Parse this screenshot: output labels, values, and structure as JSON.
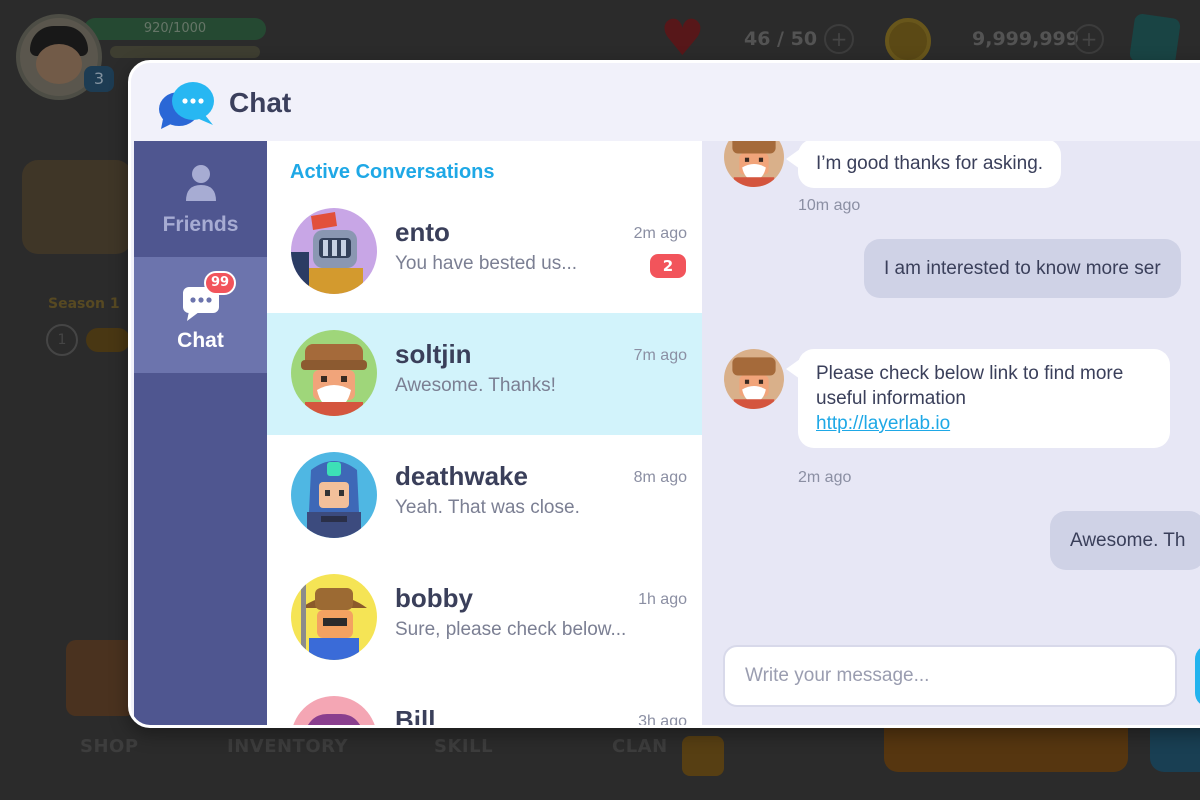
{
  "background": {
    "xp_text": "920/1000",
    "player_level": "3",
    "hearts_text": "46 / 50",
    "coins_text": "9,999,999",
    "season_label": "Season 1",
    "season_number": "1",
    "nav": [
      "SHOP",
      "INVENTORY",
      "SKILL",
      "CLAN"
    ]
  },
  "window": {
    "title": "Chat",
    "icon": "chat-bubbles-icon"
  },
  "sidebar": {
    "items": [
      {
        "label": "Friends",
        "icon": "person-icon"
      },
      {
        "label": "Chat",
        "icon": "chat-icon",
        "badge": "99"
      }
    ]
  },
  "conversations": {
    "heading": "Active Conversations",
    "items": [
      {
        "name": "ento",
        "time": "2m ago",
        "preview": "You have bested us...",
        "unread": "2",
        "avatar": "knight-avatar"
      },
      {
        "name": "soltjin",
        "time": "7m ago",
        "preview": "Awesome. Thanks!",
        "avatar": "old-man-avatar"
      },
      {
        "name": "deathwake",
        "time": "8m ago",
        "preview": "Yeah. That was close.",
        "avatar": "blue-helmet-avatar"
      },
      {
        "name": "bobby",
        "time": "1h ago",
        "preview": "Sure, please check below...",
        "avatar": "farmer-avatar"
      },
      {
        "name": "Bill",
        "time": "3h ago",
        "preview": "",
        "avatar": "purple-avatar"
      }
    ]
  },
  "messages": {
    "items": [
      {
        "text": "I’m good thanks for asking.",
        "time": "10m ago"
      },
      {
        "text": "I am interested to know more ser"
      },
      {
        "line1": "Please check below link to find more",
        "line2": "useful information",
        "link": "http://layerlab.io",
        "time": "2m ago"
      },
      {
        "text": "Awesome. Th"
      }
    ],
    "input_placeholder": "Write your message..."
  },
  "colors": {
    "sidebar": "#4f5690",
    "sidebar_active": "#6c74ad",
    "accent": "#1ea8e6",
    "selected_row": "#d2f3fb",
    "badge": "#f2545b"
  }
}
